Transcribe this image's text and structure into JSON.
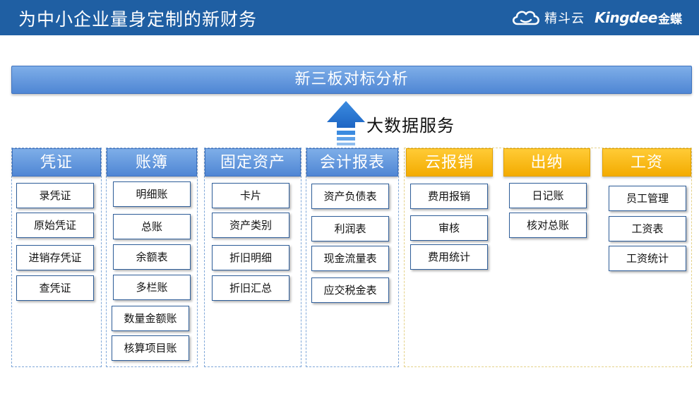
{
  "header": {
    "title": "为中小企业量身定制的新财务",
    "brand_jdy": "精斗云",
    "brand_kingdee": "Kingdee",
    "brand_jindie": "金蝶"
  },
  "banner": {
    "label": "新三板对标分析"
  },
  "big_data": {
    "label": "大数据服务"
  },
  "columns": [
    {
      "title": "凭证",
      "items": [
        "录凭证",
        "原始凭证",
        "进销存凭证",
        "查凭证"
      ]
    },
    {
      "title": "账簿",
      "items": [
        "明细账",
        "总账",
        "余额表",
        "多栏账",
        "数量金额账",
        "核算项目账"
      ]
    },
    {
      "title": "固定资产",
      "items": [
        "卡片",
        "资产类别",
        "折旧明细",
        "折旧汇总"
      ]
    },
    {
      "title": "会计报表",
      "items": [
        "资产负债表",
        "利润表",
        "现金流量表",
        "应交税金表"
      ]
    },
    {
      "title": "云报销",
      "items": [
        "费用报销",
        "审核",
        "费用统计"
      ]
    },
    {
      "title": "出纳",
      "items": [
        "日记账",
        "核对总账"
      ]
    },
    {
      "title": "工资",
      "items": [
        "员工管理",
        "工资表",
        "工资统计"
      ]
    }
  ],
  "colors": {
    "header_bg": "#1f5fa3",
    "module_blue": "#4f86d4",
    "module_gold": "#f3ab00",
    "item_border": "#2f5e99"
  }
}
